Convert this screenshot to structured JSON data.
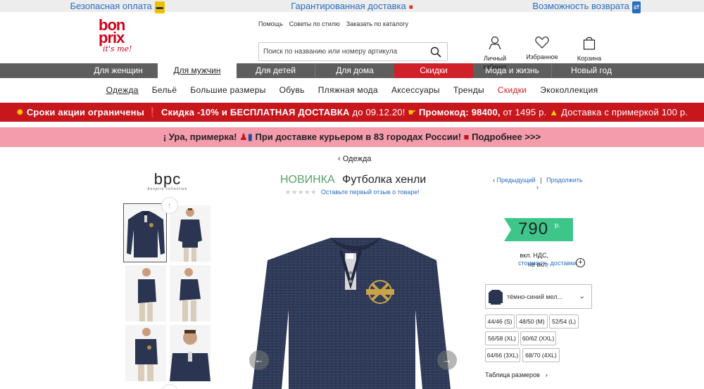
{
  "benefits": [
    {
      "text": "Безопасная оплата",
      "icon": "card-icon"
    },
    {
      "text": "Гарантированная доставка",
      "icon": "truck-icon"
    },
    {
      "text": "Возможность возврата",
      "icon": "return-icon"
    }
  ],
  "logo": {
    "line1": "bon",
    "line2": "prix",
    "tagline": "it's me!"
  },
  "toplinks": [
    "Помощь",
    "Советы по стилю",
    "Заказать по каталогу"
  ],
  "search": {
    "placeholder": "Поиск по названию или номеру артикула"
  },
  "header_icons": {
    "account": "Личный кабинет",
    "favorites": "Избранное",
    "cart": "Корзина"
  },
  "nav": [
    "Для женщин",
    "Для мужчин",
    "Для детей",
    "Для дома",
    "Скидки",
    "Мода и жизнь",
    "Новый год"
  ],
  "subnav": [
    "Одежда",
    "Бельё",
    "Большие размеры",
    "Обувь",
    "Пляжная мода",
    "Аксессуары",
    "Тренды",
    "Скидки",
    "Экоколлекция"
  ],
  "promo1": {
    "part1": "Сроки акции ограничены",
    "part2": "Скидка",
    "part3": "-10% и БЕСПЛАТНАЯ ДОСТАВКА",
    "part4": "до 09.12.20!",
    "part5": "Промокод: 98400,",
    "part6": "от 1495 р.",
    "part7": "Доставка с примеркой 100 р."
  },
  "promo2": {
    "part1": "¡ Ура, примерка!",
    "part2": "При доставке курьером в 83 городах России!",
    "part3": "Подробнее >>>"
  },
  "breadcrumb": "Одежда",
  "brand": {
    "name": "bpc",
    "sub": "bonprix collection"
  },
  "product": {
    "badge": "НОВИНКА",
    "title": "Футболка хенли",
    "review_link": "Оставьте первый отзыв о товаре!"
  },
  "pager": {
    "prev": "Предыдущий",
    "next": "Продолжить"
  },
  "price": {
    "value": "790",
    "currency": "р."
  },
  "vat": {
    "line1": "вкл. НДС,",
    "line2": "не вкл.",
    "shipping_link": "стоимость доставки"
  },
  "color": {
    "label": "тёмно-синий мел..."
  },
  "sizes": [
    "44/46 (S)",
    "48/50 (M)",
    "52/54 (L)",
    "56/58 (XL)",
    "60/62 (XXL)",
    "64/66 (3XL)",
    "68/70 (4XL)"
  ],
  "size_table": "Таблица размеров",
  "colors": {
    "brand_red": "#d0021b",
    "nav_gray": "#5e5e5e",
    "sale_red": "#d0202a",
    "promo_red": "#c8161d",
    "promo_pink": "#f49bac",
    "link_blue": "#2a6ec2",
    "price_green": "#3ec68a"
  }
}
